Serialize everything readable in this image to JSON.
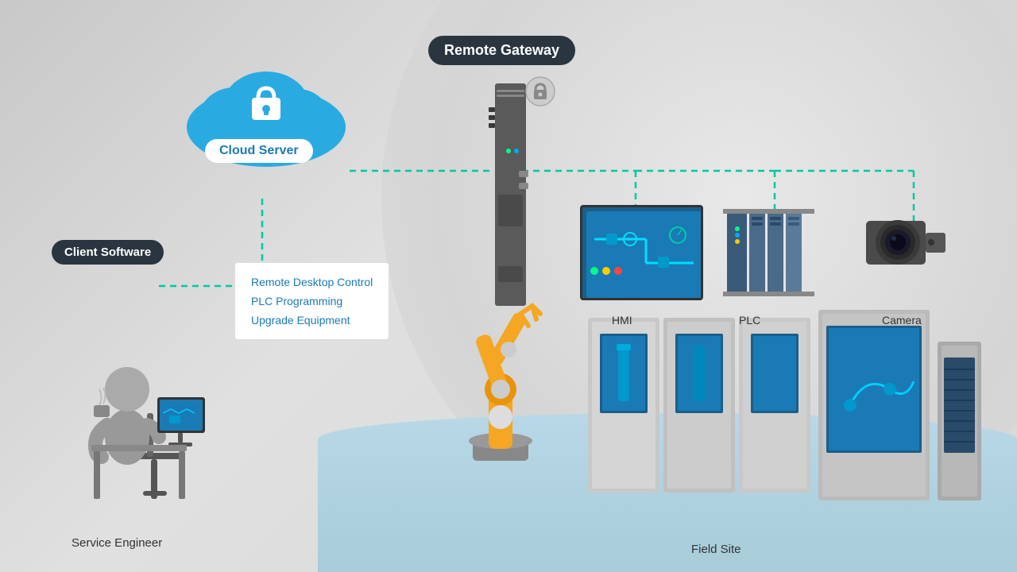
{
  "labels": {
    "remote_gateway": "Remote Gateway",
    "cloud_server": "Cloud Server",
    "client_software": "Client Software",
    "service_engineer": "Service Engineer",
    "field_site": "Field Site",
    "hmi": "HMI",
    "plc": "PLC",
    "camera": "Camera"
  },
  "features": [
    "Remote Desktop Control",
    "PLC Programming",
    "Upgrade Equipment"
  ],
  "colors": {
    "teal_dashed": "#00c8a0",
    "dark_bg": "#2a3540",
    "blue_accent": "#1a7ab5",
    "cloud_blue": "#29abe2",
    "robot_orange": "#f5a623",
    "robot_dark": "#e8940a"
  }
}
